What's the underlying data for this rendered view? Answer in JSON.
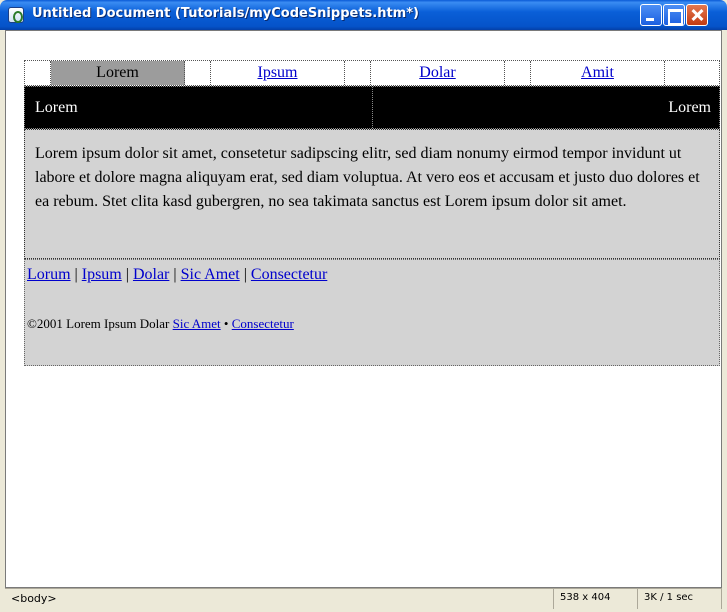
{
  "window": {
    "title": "Untitled Document (Tutorials/myCodeSnippets.htm*)"
  },
  "nav": {
    "items": [
      "Lorem",
      "Ipsum",
      "Dolar",
      "Amit"
    ],
    "active": "Lorem"
  },
  "header_bar": {
    "left": "Lorem",
    "right": "Lorem"
  },
  "body_text": "Lorem ipsum dolor sit amet, consetetur sadipscing elitr, sed diam nonumy eirmod tempor invidunt ut labore et dolore magna aliquyam erat, sed diam voluptua. At vero eos et accusam et justo duo dolores et ea rebum. Stet clita kasd gubergren, no sea takimata sanctus est Lorem ipsum dolor sit amet.",
  "footer": {
    "links": [
      "Lorum",
      "Ipsum",
      "Dolar",
      "Sic Amet",
      "Consectetur"
    ],
    "separator": " | ",
    "copyright_text": "©2001 Lorem Ipsum Dolar",
    "copyright_link1": "Sic Amet",
    "copyright_bullet": "•",
    "copyright_link2": "Consectetur"
  },
  "statusbar": {
    "tag": "<body>",
    "window_size": "538 x 404",
    "download": "3K / 1 sec"
  },
  "colors": {
    "titlebar": "#0553c9",
    "nav_active": "#9c9c9c",
    "header_bar": "#000000",
    "content_bg": "#d3d3d3",
    "link": "#0000cc"
  }
}
